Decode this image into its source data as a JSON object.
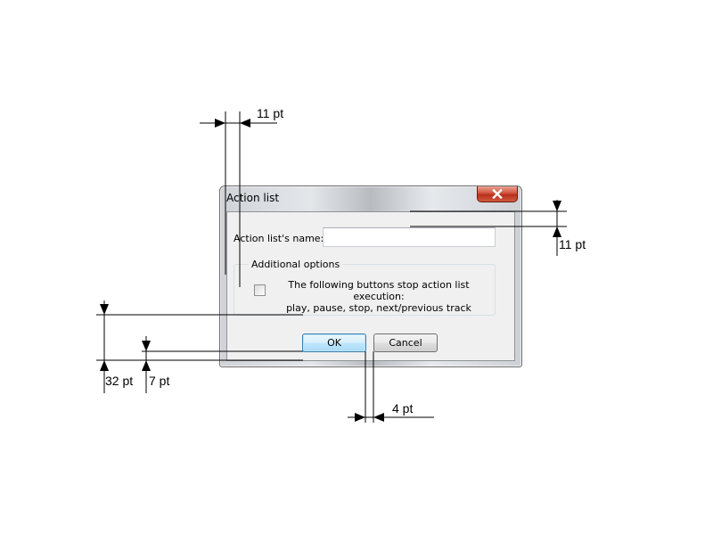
{
  "dialog": {
    "title": "Action list",
    "name_label": "Action list's name:",
    "name_value": "",
    "group_title": "Additional options",
    "checkbox_text_line1": "The following buttons stop action list execution:",
    "checkbox_text_line2": "play, pause, stop, next/previous track",
    "checkbox_checked": false,
    "ok_label": "OK",
    "cancel_label": "Cancel"
  },
  "dimensions": {
    "top_margin": "11 pt",
    "left_margin": "11 pt",
    "group_to_window_bottom": "32 pt",
    "buttons_bottom_margin": "7 pt",
    "button_spacing": "4 pt"
  },
  "colors": {
    "accent_button_border": "#3c7fb1",
    "close_button": "#c7432e"
  }
}
